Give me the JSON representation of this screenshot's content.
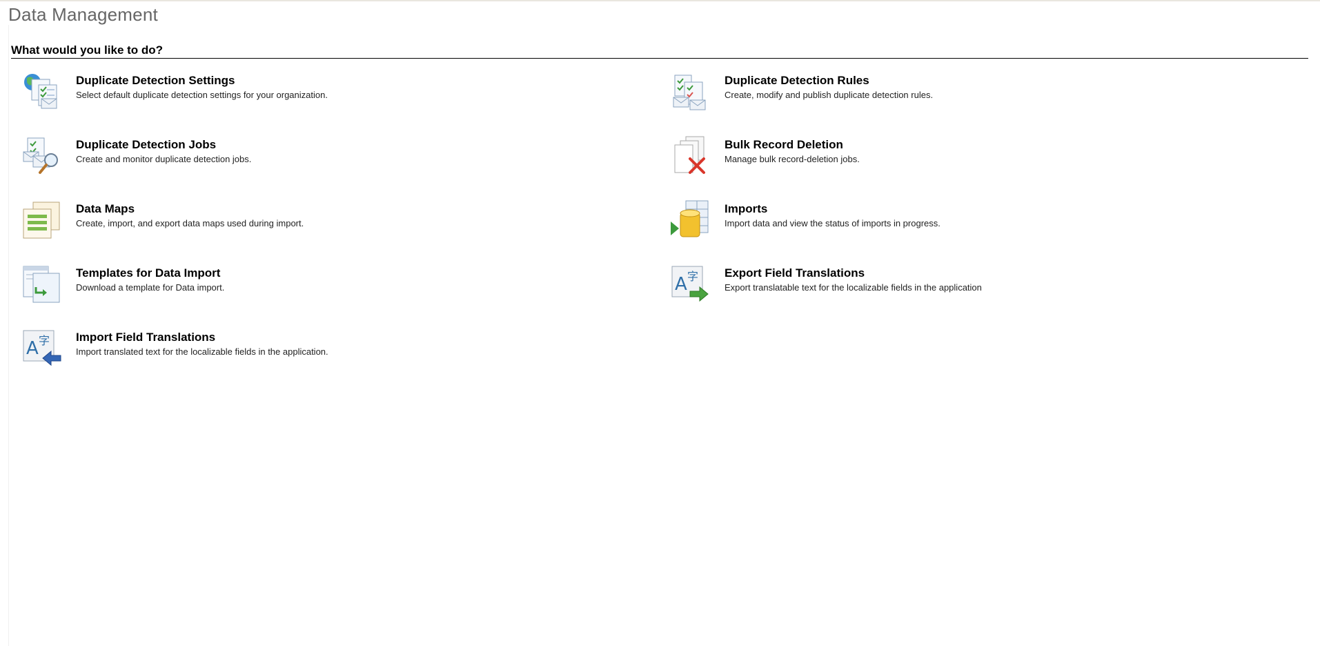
{
  "page": {
    "title": "Data Management",
    "section_header": "What would you like to do?"
  },
  "items": [
    {
      "title": "Duplicate Detection Settings",
      "description": "Select default duplicate detection settings for your organization.",
      "icon": "duplicate-detection-settings-icon"
    },
    {
      "title": "Duplicate Detection Rules",
      "description": "Create, modify and publish duplicate detection rules.",
      "icon": "duplicate-detection-rules-icon"
    },
    {
      "title": "Duplicate Detection Jobs",
      "description": "Create and monitor duplicate detection jobs.",
      "icon": "duplicate-detection-jobs-icon"
    },
    {
      "title": "Bulk Record Deletion",
      "description": "Manage bulk record-deletion jobs.",
      "icon": "bulk-record-deletion-icon"
    },
    {
      "title": "Data Maps",
      "description": "Create, import, and export data maps used during import.",
      "icon": "data-maps-icon"
    },
    {
      "title": "Imports",
      "description": "Import data and view the status of imports in progress.",
      "icon": "imports-icon"
    },
    {
      "title": "Templates for Data Import",
      "description": "Download a template for Data import.",
      "icon": "templates-for-data-import-icon"
    },
    {
      "title": "Export Field Translations",
      "description": "Export translatable text for the localizable fields in the application",
      "icon": "export-field-translations-icon"
    },
    {
      "title": "Import Field Translations",
      "description": "Import translated text for the localizable fields in the application.",
      "icon": "import-field-translations-icon"
    }
  ]
}
